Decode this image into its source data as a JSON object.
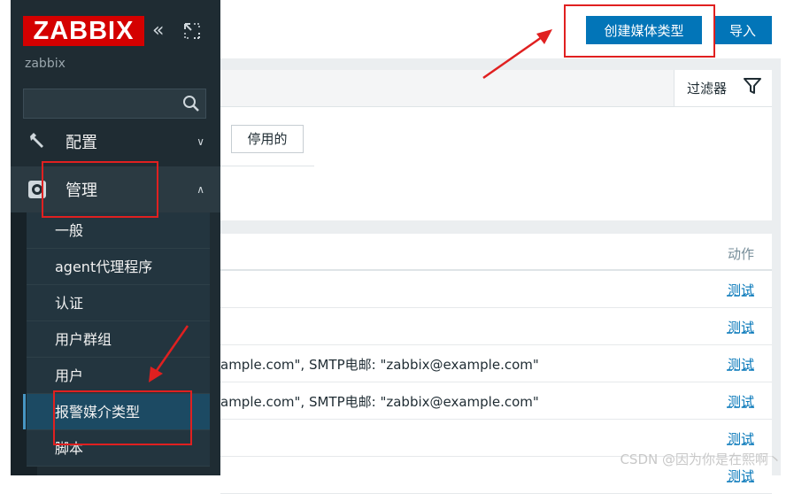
{
  "sidebar": {
    "logo": "ZABBIX",
    "server_name": "zabbix",
    "menu": {
      "config_label": "配置",
      "admin_label": "管理"
    },
    "admin_items": [
      {
        "label": "一般"
      },
      {
        "label": "agent代理程序"
      },
      {
        "label": "认证"
      },
      {
        "label": "用户群组"
      },
      {
        "label": "用户"
      },
      {
        "label": "报警媒介类型"
      },
      {
        "label": "脚本"
      }
    ]
  },
  "toolbar": {
    "create_label": "创建媒体类型",
    "import_label": "导入"
  },
  "filter": {
    "tab_label": "过滤器",
    "disabled_label": "停用的"
  },
  "table": {
    "action_header": "动作",
    "rows": [
      {
        "details": "",
        "test": "测试"
      },
      {
        "details": "",
        "test": "测试"
      },
      {
        "details": "ample.com\", SMTP电邮: \"zabbix@example.com\"",
        "test": "测试"
      },
      {
        "details": "ample.com\", SMTP电邮: \"zabbix@example.com\"",
        "test": "测试"
      },
      {
        "details": "",
        "test": "测试"
      },
      {
        "details": "",
        "test": "测试"
      }
    ]
  },
  "watermark": "CSDN @因为你是在熙啊丶",
  "colors": {
    "sidebar_bg": "#1f2c33",
    "logo_red": "#d40000",
    "primary_button": "#0275b8",
    "annotation_red": "#e02020"
  },
  "icons": {
    "collapse": "double-chevron-left-icon",
    "kiosk": "expand-icon",
    "search": "search-icon",
    "config": "wrench-icon",
    "admin": "gear-icon",
    "filter": "funnel-icon"
  }
}
